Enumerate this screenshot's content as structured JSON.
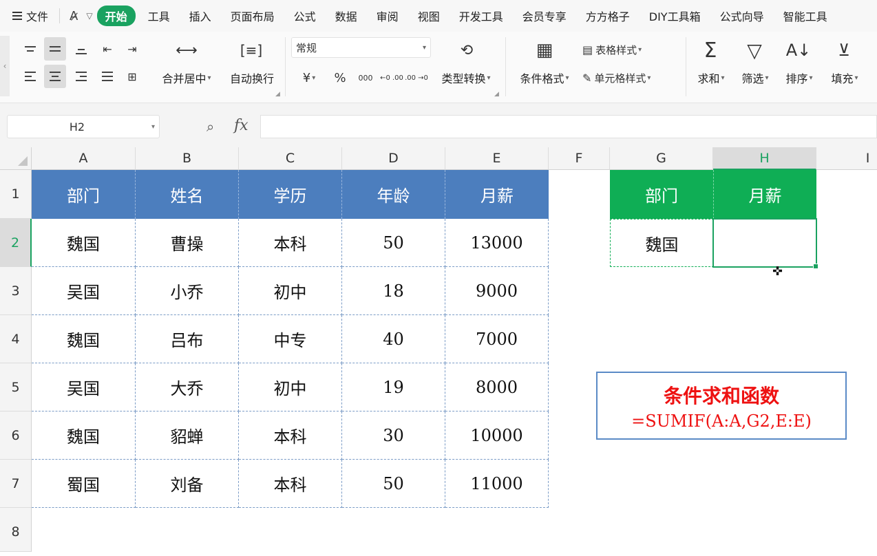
{
  "menu": {
    "file": "文件",
    "tabs": [
      "开始",
      "工具",
      "插入",
      "页面布局",
      "公式",
      "数据",
      "审阅",
      "视图",
      "开发工具",
      "会员专享",
      "方方格子",
      "DIY工具箱",
      "公式向导",
      "智能工具"
    ],
    "active_tab": "开始"
  },
  "ribbon": {
    "merge_center": "合并居中",
    "wrap_text": "自动换行",
    "number_format": "常规",
    "currency": "¥",
    "percent": "%",
    "thousands": "000",
    "dec_inc": "←0 .00",
    "dec_dec": ".00 →0",
    "type_convert": "类型转换",
    "conditional_format": "条件格式",
    "table_style": "表格样式",
    "cell_style": "单元格样式",
    "sum": "求和",
    "filter": "筛选",
    "sort": "排序",
    "fill": "填充"
  },
  "formula_bar": {
    "name_box": "H2",
    "fx": "fx",
    "formula": ""
  },
  "grid": {
    "columns": [
      "A",
      "B",
      "C",
      "D",
      "E",
      "F",
      "G",
      "H",
      "I"
    ],
    "rows": [
      "1",
      "2",
      "3",
      "4",
      "5",
      "6",
      "7",
      "8"
    ],
    "active_column": "H",
    "active_row": "2"
  },
  "table": {
    "headers": [
      "部门",
      "姓名",
      "学历",
      "年龄",
      "月薪"
    ],
    "rows": [
      [
        "魏国",
        "曹操",
        "本科",
        "50",
        "13000"
      ],
      [
        "吴国",
        "小乔",
        "初中",
        "18",
        "9000"
      ],
      [
        "魏国",
        "吕布",
        "中专",
        "40",
        "7000"
      ],
      [
        "吴国",
        "大乔",
        "初中",
        "19",
        "8000"
      ],
      [
        "魏国",
        "貂蝉",
        "本科",
        "30",
        "10000"
      ],
      [
        "蜀国",
        "刘备",
        "本科",
        "50",
        "11000"
      ]
    ]
  },
  "lookup": {
    "headers": [
      "部门",
      "月薪"
    ],
    "dept": "魏国",
    "salary": ""
  },
  "note": {
    "title": "条件求和函数",
    "formula": "=SUMIF(A:A,G2,E:E)"
  },
  "colors": {
    "accent": "#1aa260",
    "table_header": "#4c7ebe",
    "lookup_header": "#0fae55",
    "note_text": "#ee1111"
  }
}
